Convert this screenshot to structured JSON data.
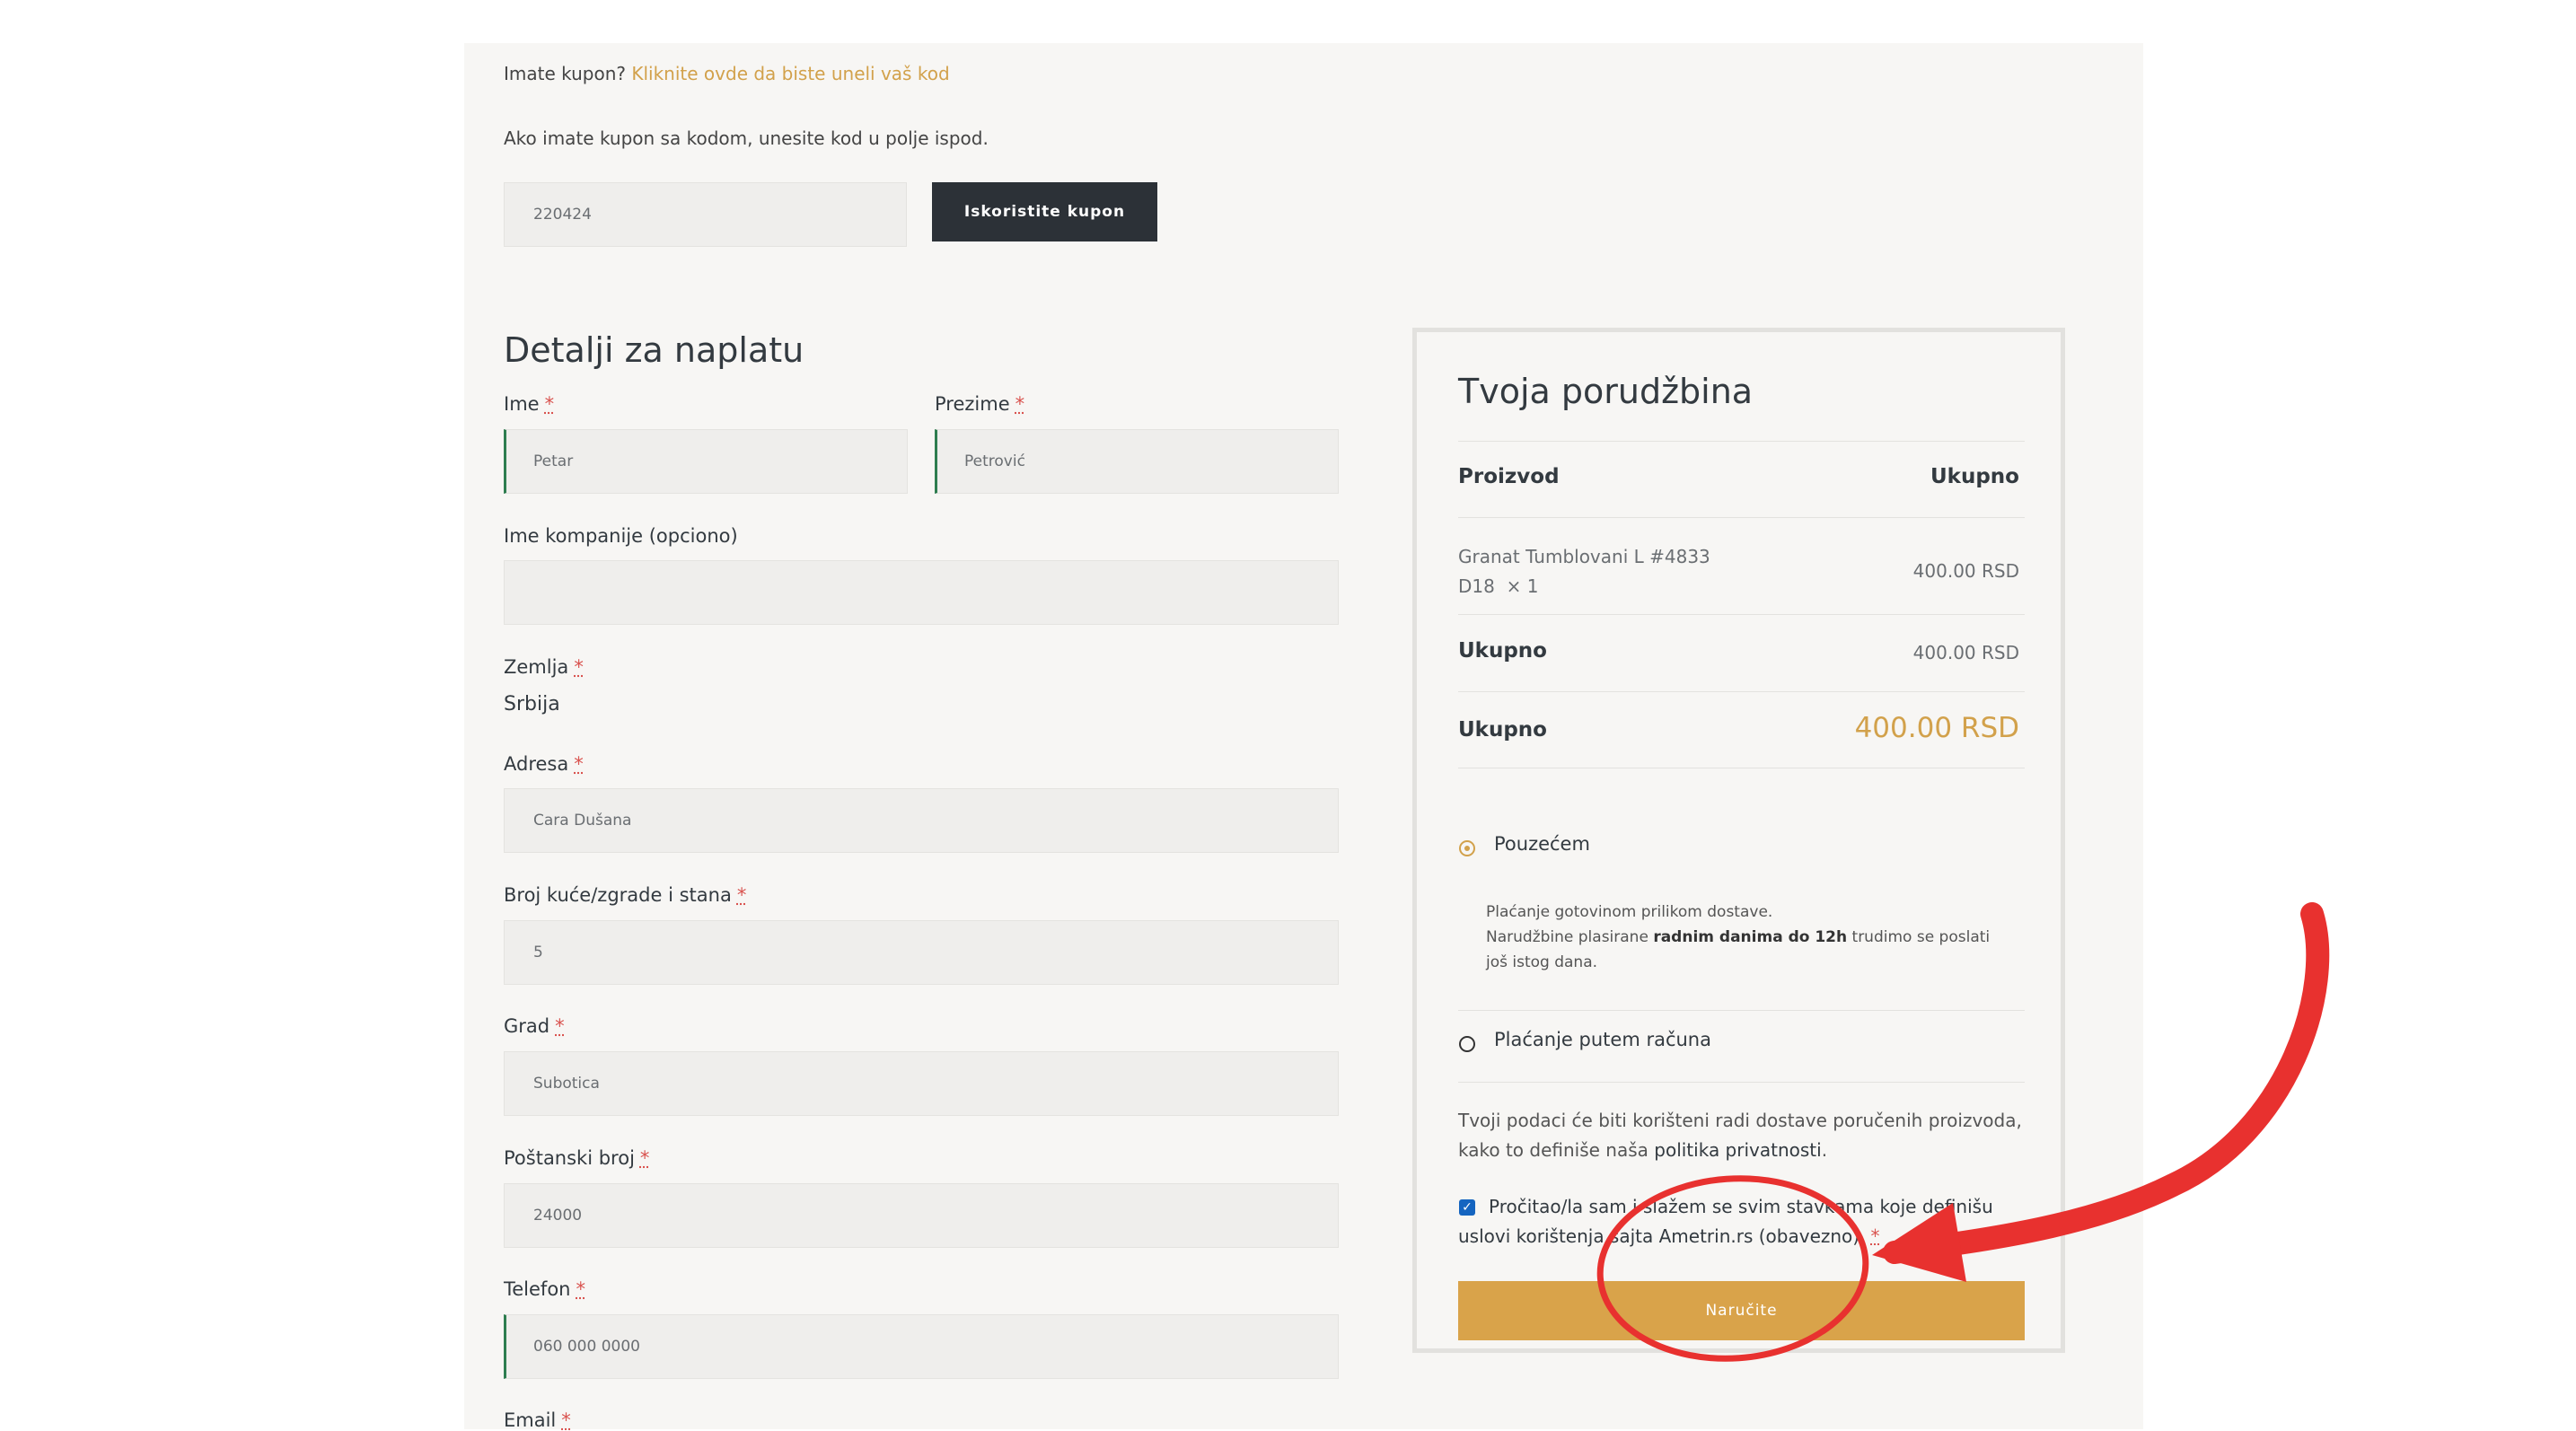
{
  "coupon": {
    "prompt": "Imate kupon?",
    "link": "Kliknite ovde da biste uneli vaš kod",
    "instructions": "Ako imate kupon sa kodom, unesite kod u polje ispod.",
    "code": "220424",
    "apply_label": "Iskoristite kupon"
  },
  "billing": {
    "title": "Detalji za naplatu",
    "required_mark": "*",
    "first_name": {
      "label": "Ime",
      "value": "Petar"
    },
    "last_name": {
      "label": "Prezime",
      "value": "Petrović"
    },
    "company": {
      "label": "Ime kompanije (opciono)",
      "value": ""
    },
    "country": {
      "label": "Zemlja",
      "value": "Srbija"
    },
    "address": {
      "label": "Adresa",
      "value": "Cara Dušana"
    },
    "house": {
      "label": "Broj kuće/zgrade i stana",
      "value": "5"
    },
    "city": {
      "label": "Grad",
      "value": "Subotica"
    },
    "postcode": {
      "label": "Poštanski broj",
      "value": "24000"
    },
    "phone": {
      "label": "Telefon",
      "value": "060 000 0000"
    },
    "email": {
      "label": "Email"
    }
  },
  "order": {
    "title": "Tvoja porudžbina",
    "col_product": "Proizvod",
    "col_total": "Ukupno",
    "item_name_line1": "Granat Tumblovani L #4833",
    "item_name_line2": "D18",
    "item_qty": "× 1",
    "item_price": "400.00 RSD",
    "subtotal_label": "Ukupno",
    "subtotal_value": "400.00 RSD",
    "total_label": "Ukupno",
    "total_value": "400.00 RSD",
    "payment_cod": "Pouzećem",
    "cod_desc_1": "Plaćanje gotovinom prilikom dostave.",
    "cod_desc_2a": "Narudžbine plasirane ",
    "cod_desc_2b": "radnim danima do 12h",
    "cod_desc_2c": " trudimo se poslati",
    "cod_desc_3": "još istog dana.",
    "payment_invoice": "Plaćanje putem računa",
    "privacy_1": "Tvoji podaci će biti korišteni radi dostave poručenih proizvoda,",
    "privacy_2a": "kako to definiše naša ",
    "privacy_link": "politika privatnosti",
    "privacy_2c": ".",
    "terms_1": "Pročitao/la sam i slažem se svim stavkama koje definišu",
    "terms_2": "uslovi korištenja sajta Ametrin.rs (obavezno).",
    "place_order": "Naručite"
  },
  "colors": {
    "accent": "#d2a14b",
    "dark_button": "#2c3137",
    "annotation": "#e8312f"
  }
}
